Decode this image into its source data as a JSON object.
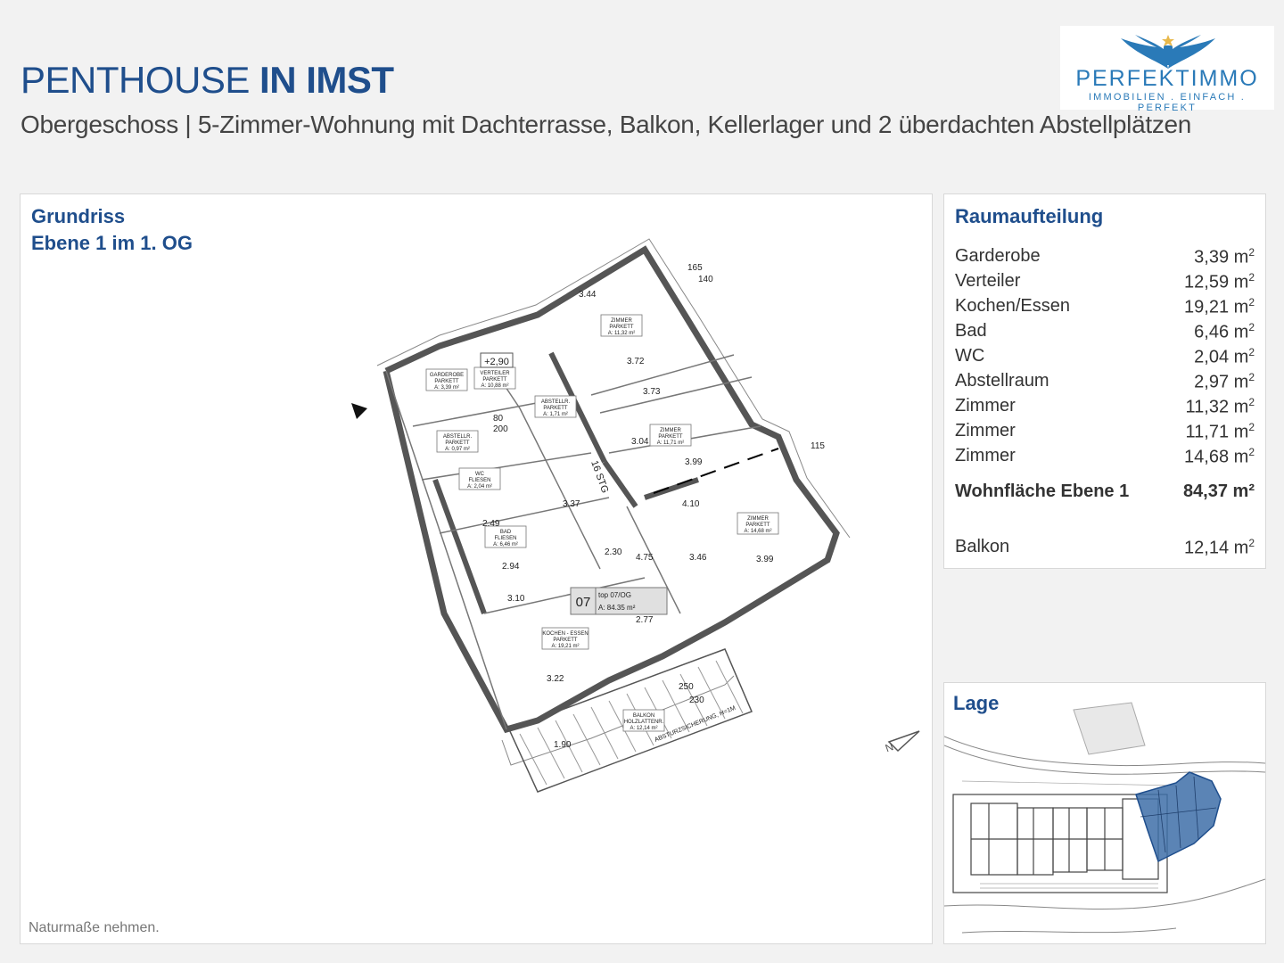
{
  "header": {
    "title_light": "PENTHOUSE ",
    "title_bold": "IN IMST",
    "subtitle": "Obergeschoss | 5-Zimmer-Wohnung mit Dachterrasse, Balkon, Kellerlager und 2 überdachten Abstellplätzen"
  },
  "logo": {
    "name": "PERFEKTIMMO",
    "tagline": "IMMOBILIEN . EINFACH . PERFEKT",
    "color": "#2a7ab8"
  },
  "floorplan": {
    "heading_line1": "Grundriss",
    "heading_line2": "Ebene 1 im 1. OG",
    "footnote": "Naturmaße nehmen.",
    "unit_number": "07",
    "unit_label": "top 07/OG",
    "unit_area": "A: 84.35 m²",
    "labels": {
      "zimmer": "ZIMMER",
      "parkett": "PARKETT",
      "fliesen": "FLIESEN",
      "garderobe": "GARDEROBE",
      "verteiler": "VERTEILER",
      "abstellr": "ABSTELLR.",
      "wc": "WC",
      "bad": "BAD",
      "kochen_essen": "KOCHEN - ESSEN",
      "balkon": "BALKON",
      "holzlattenr": "HOLZLATTENR.",
      "absturz": "ABSTURZSICHERUNG, H=1M",
      "stg": "16 STG",
      "level": "+2,90",
      "area_zimmer1": "A: 11,32 m²",
      "area_zimmer2": "A: 11,71 m²",
      "area_zimmer3": "A: 14,68 m²",
      "area_garderobe": "A: 3,39 m²",
      "area_verteiler": "A: 10,88 m²",
      "area_abstell1": "A: 1,71 m²",
      "area_abstell2": "A: 0,97 m²",
      "area_wc": "A: 2,04 m²",
      "area_bad": "A: 6,46 m²",
      "area_kochen": "A: 19,21 m²",
      "area_balkon": "A: 12,14 m²"
    },
    "dimensions": [
      "3.44",
      "3.72",
      "3.73",
      "3.99",
      "3.99",
      "4.10",
      "2.30",
      "4.75",
      "2.77",
      "3.22",
      "3.10",
      "2.94",
      "2.49",
      "3.37",
      "3.04",
      "3.46",
      "165",
      "140",
      "115",
      "250",
      "230",
      "1.90",
      "80",
      "200"
    ]
  },
  "rooms_panel": {
    "heading": "Raumaufteilung",
    "rooms": [
      {
        "name": "Garderobe",
        "value": "3,39 m",
        "sup": "2"
      },
      {
        "name": "Verteiler",
        "value": "12,59 m",
        "sup": "2"
      },
      {
        "name": "Kochen/Essen",
        "value": "19,21 m",
        "sup": "2"
      },
      {
        "name": "Bad",
        "value": "6,46 m",
        "sup": "2"
      },
      {
        "name": "WC",
        "value": "2,04 m",
        "sup": "2"
      },
      {
        "name": "Abstellraum",
        "value": "2,97 m",
        "sup": "2"
      },
      {
        "name": "Zimmer",
        "value": "11,32 m",
        "sup": "2"
      },
      {
        "name": "Zimmer",
        "value": "11,71 m",
        "sup": "2"
      },
      {
        "name": "Zimmer",
        "value": "14,68 m",
        "sup": "2"
      }
    ],
    "total": {
      "name": "Wohnfläche Ebene 1",
      "value": "84,37 m²"
    },
    "balkon": {
      "name": "Balkon",
      "value": "12,14 m",
      "sup": "2"
    }
  },
  "lage": {
    "heading": "Lage",
    "highlight_color": "#3e6ea8"
  }
}
